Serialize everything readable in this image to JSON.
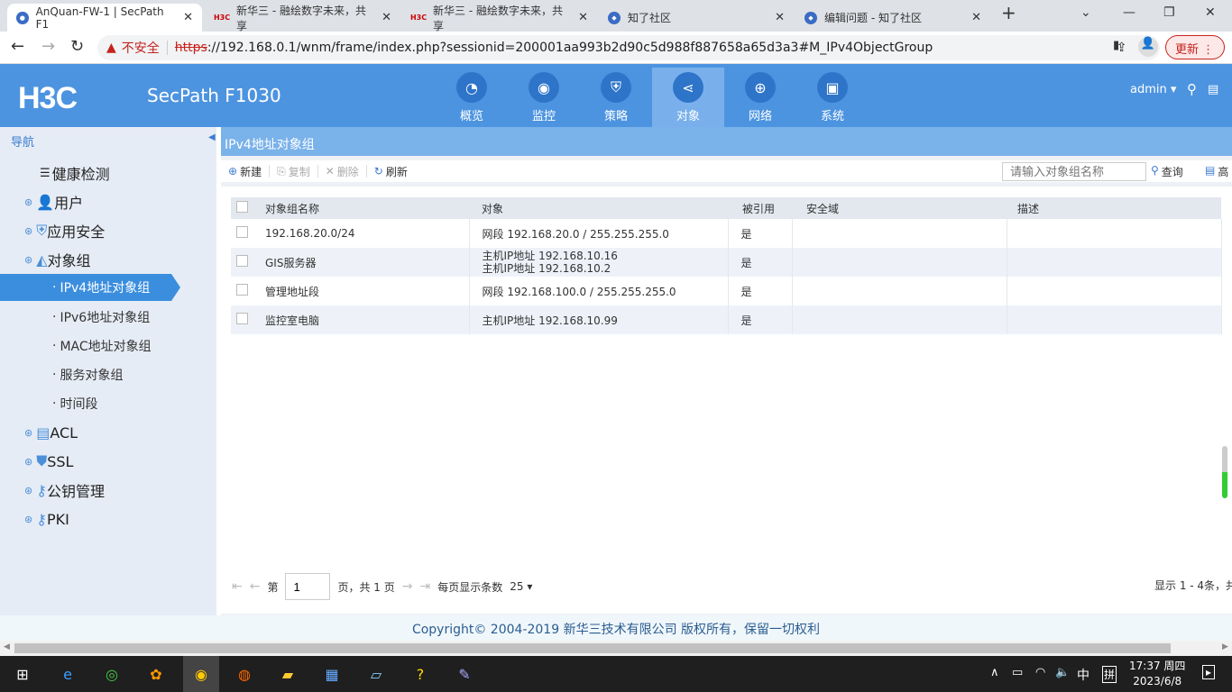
{
  "browser": {
    "tabs": [
      {
        "title": "AnQuan-FW-1 | SecPath F1",
        "favicon": "globe-icon"
      },
      {
        "title": "新华三 - 融绘数字未来，共享",
        "favicon": "H3C"
      },
      {
        "title": "新华三 - 融绘数字未来，共享",
        "favicon": "H3C"
      },
      {
        "title": "知了社区",
        "favicon": "drop-icon"
      },
      {
        "title": "编辑问题 - 知了社区",
        "favicon": "drop-icon"
      }
    ],
    "insecure_label": "不安全",
    "url_scheme": "https",
    "url_rest": "://192.168.0.1/wnm/frame/index.php?sessionid=200001aa993b2d90c5d988f887658a65d3a3#M_IPv4ObjectGroup",
    "update_label": "更新"
  },
  "header": {
    "logo": "H3C",
    "product": "SecPath F1030",
    "user": "admin",
    "nav": [
      {
        "label": "概览",
        "icon": "gauge-icon"
      },
      {
        "label": "监控",
        "icon": "camera-icon"
      },
      {
        "label": "策略",
        "icon": "shield-icon"
      },
      {
        "label": "对象",
        "icon": "share-icon"
      },
      {
        "label": "网络",
        "icon": "globe-icon"
      },
      {
        "label": "系统",
        "icon": "monitor-icon"
      }
    ],
    "active": "对象"
  },
  "sidebar": {
    "title": "导航",
    "items": [
      {
        "label": "健康检测"
      },
      {
        "label": "用户"
      },
      {
        "label": "应用安全"
      },
      {
        "label": "对象组"
      },
      {
        "label": "IPv4地址对象组"
      },
      {
        "label": "IPv6地址对象组"
      },
      {
        "label": "MAC地址对象组"
      },
      {
        "label": "服务对象组"
      },
      {
        "label": "时间段"
      },
      {
        "label": "ACL"
      },
      {
        "label": "SSL"
      },
      {
        "label": "公钥管理"
      },
      {
        "label": "PKI"
      }
    ]
  },
  "main": {
    "title": "IPv4地址对象组",
    "toolbar": {
      "new": "新建",
      "copy": "复制",
      "delete": "删除",
      "refresh": "刷新",
      "search_placeholder": "请输入对象组名称",
      "query": "查询",
      "advanced": "高"
    },
    "columns": [
      "对象组名称",
      "对象",
      "被引用",
      "安全域",
      "描述"
    ],
    "rows": [
      {
        "name": "192.168.20.0/24",
        "object": "网段 192.168.20.0 / 255.255.255.0",
        "object2": "",
        "ref": "是",
        "zone": "",
        "desc": ""
      },
      {
        "name": "GIS服务器",
        "object": "主机IP地址 192.168.10.16",
        "object2": "主机IP地址 192.168.10.2",
        "ref": "是",
        "zone": "",
        "desc": ""
      },
      {
        "name": "管理地址段",
        "object": "网段 192.168.100.0 / 255.255.255.0",
        "object2": "",
        "ref": "是",
        "zone": "",
        "desc": ""
      },
      {
        "name": "监控室电脑",
        "object": "主机IP地址 192.168.10.99",
        "object2": "",
        "ref": "是",
        "zone": "",
        "desc": ""
      }
    ],
    "pager": {
      "page_prefix": "第",
      "page": "1",
      "page_suffix": "页，共 1 页",
      "per_page_label": "每页显示条数",
      "per_page": "25",
      "summary": "显示 1 - 4条，共"
    }
  },
  "footer": "Copyright© 2004-2019 新华三技术有限公司 版权所有，保留一切权利",
  "taskbar": {
    "time": "17:37 周四",
    "date": "2023/6/8",
    "ime": "中",
    "ime2": "拼"
  }
}
